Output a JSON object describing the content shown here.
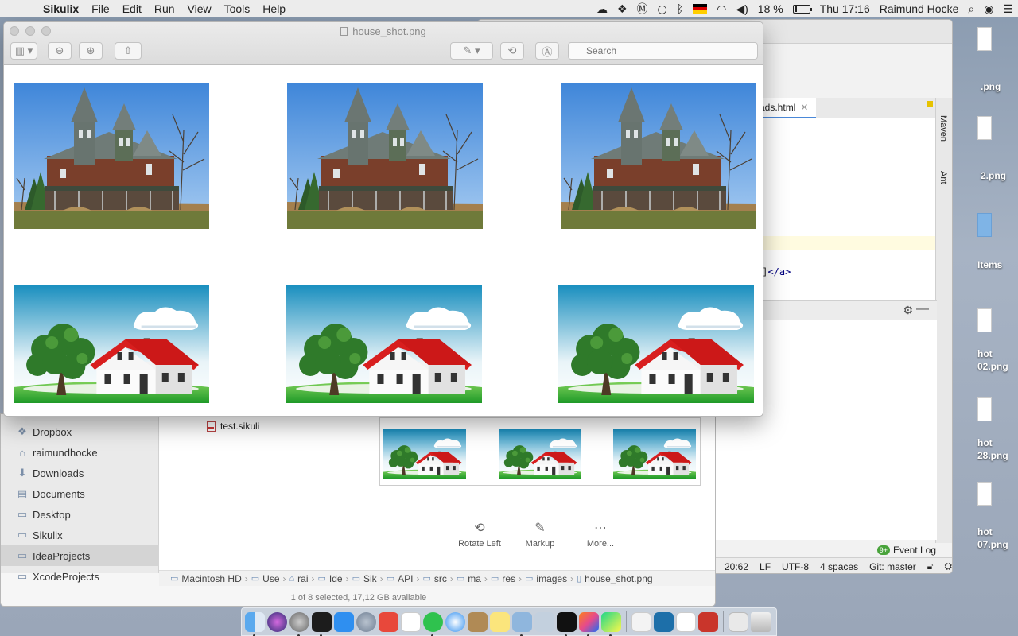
{
  "menubar": {
    "app": "Sikulix",
    "menus": [
      "File",
      "Edit",
      "Run",
      "View",
      "Tools",
      "Help"
    ],
    "battery": "18 %",
    "clock": "Thu 17:16",
    "user": "Raimund Hocke",
    "battery_level": 0.18
  },
  "quicklook": {
    "title": "house_shot.png",
    "search_placeholder": "Search"
  },
  "ide": {
    "tab_label": "ads.html",
    "code_tail_prefix": "r]",
    "code_tag": "</a>",
    "right_tools": [
      "Maven",
      "Ant"
    ],
    "event_log": "Event Log",
    "event_badge": "9+",
    "status": {
      "position": "20:62",
      "line_sep": "LF",
      "encoding": "UTF-8",
      "indent": "4 spaces",
      "vcs": "Git: master"
    }
  },
  "finder": {
    "sidebar": [
      "Dropbox",
      "raimundhocke",
      "Downloads",
      "Documents",
      "Desktop",
      "Sikulix",
      "IdeaProjects",
      "XcodeProjects"
    ],
    "selected_sidebar": "IdeaProjects",
    "file": "test.sikuli",
    "actions": [
      "Rotate Left",
      "Markup",
      "More..."
    ],
    "path": [
      "Macintosh HD",
      "Use",
      "rai",
      "Ide",
      "Sik",
      "API",
      "src",
      "ma",
      "res",
      "images",
      "house_shot.png"
    ],
    "status": "1 of 8 selected, 17,12 GB available"
  },
  "desktop": {
    "items": [
      ".png",
      "2.png",
      "Items",
      "hot",
      "02.png",
      "hot",
      "28.png",
      "hot",
      "07.png"
    ]
  }
}
